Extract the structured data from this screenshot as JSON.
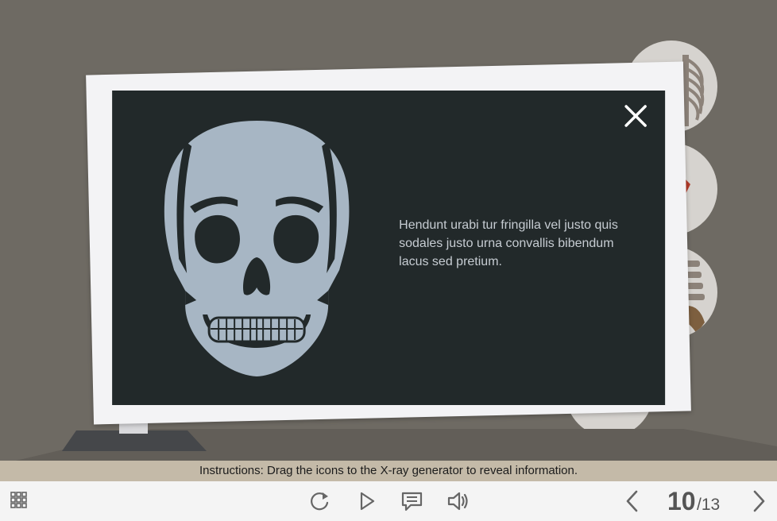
{
  "xray": {
    "info_text": "Hendunt urabi tur fringilla vel justo quis sodales justo urna convallis bibendum lacus sed pretium."
  },
  "instructions": {
    "text": "Instructions: Drag the icons to the X-ray generator to reveal information."
  },
  "toolbar": {
    "page_current": "10",
    "page_total": "/13"
  },
  "icons": {
    "menu": "grid-icon",
    "replay": "replay-icon",
    "play": "play-icon",
    "transcript": "comment-icon",
    "audio": "speaker-icon",
    "prev": "chevron-left-icon",
    "next": "chevron-right-icon",
    "close": "close-icon"
  },
  "colors": {
    "background": "#6e6a63",
    "screen": "#22292a",
    "bone": "#a7b6c4",
    "instructions_bar": "#c4baa8",
    "toolbar": "#f4f4f4"
  }
}
